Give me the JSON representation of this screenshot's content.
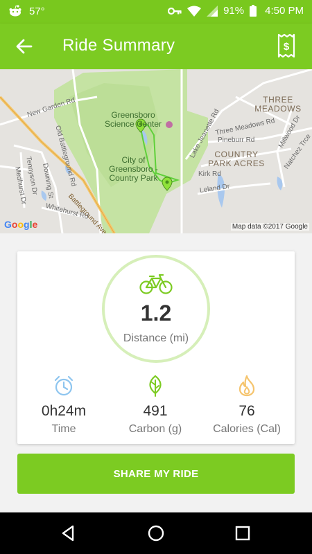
{
  "status_bar": {
    "temperature": "57°",
    "battery": "91%",
    "time": "4:50 PM",
    "icons": [
      "reddit-icon",
      "key-icon",
      "wifi-icon",
      "signal-icon",
      "battery-icon"
    ]
  },
  "app_bar": {
    "title": "Ride Summary",
    "back_icon": "arrow-left-icon",
    "receipt_icon": "receipt-dollar-icon",
    "color": "#7ccb22"
  },
  "map": {
    "streets": [
      "New Garden Rd",
      "Old Battleground Rd",
      "Tennyson Dr",
      "Downing St",
      "Medhurst Dr",
      "Battleground Ave",
      "Whitehurst Rd",
      "Lake Jeanette Rd",
      "Three Meadows Rd",
      "Pineburr Rd",
      "Kirk Rd",
      "Leland Dr",
      "Millwood Dr",
      "Natchez Trce"
    ],
    "places": [
      "THREE MEADOWS",
      "COUNTRY PARK ACRES"
    ],
    "poi": "Greensboro Science Center",
    "park": "City of Greensboro - Country Park",
    "google": "Google",
    "attribution": "Map data ©2017 Google"
  },
  "summary": {
    "distance_value": "1.2",
    "distance_label": "Distance (mi)",
    "stats": [
      {
        "icon": "clock-icon",
        "value": "0h24m",
        "label": "Time",
        "color": "#8ec5ef"
      },
      {
        "icon": "leaf-icon",
        "value": "491",
        "label": "Carbon (g)",
        "color": "#7ccb22"
      },
      {
        "icon": "flame-icon",
        "value": "76",
        "label": "Calories (Cal)",
        "color": "#f5c46d"
      }
    ]
  },
  "share_button": "SHARE MY RIDE",
  "nav_bar": [
    "back-triangle-icon",
    "home-circle-icon",
    "recents-square-icon"
  ]
}
